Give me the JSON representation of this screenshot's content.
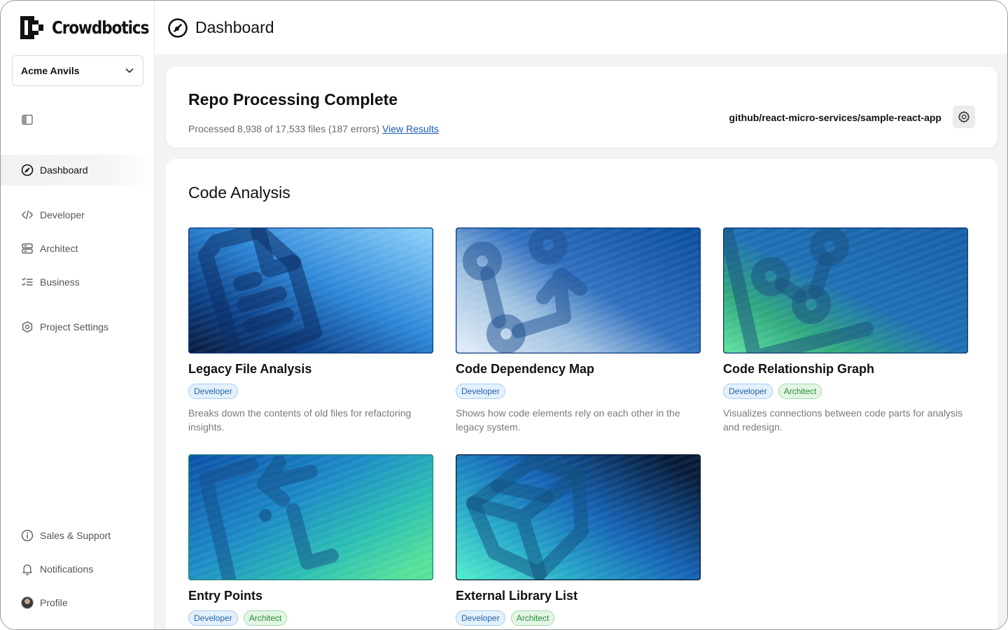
{
  "brand": {
    "name": "Crowdbotics"
  },
  "org_selector": {
    "value": "Acme Anvils"
  },
  "sidebar": {
    "nav": [
      {
        "label": "Dashboard",
        "icon": "dashboard-icon",
        "active": true
      },
      {
        "label": "Developer",
        "icon": "code-icon"
      },
      {
        "label": "Architect",
        "icon": "server-icon"
      },
      {
        "label": "Business",
        "icon": "checklist-icon"
      },
      {
        "label": "Project Settings",
        "icon": "settings-hexagon-icon"
      }
    ],
    "footer": [
      {
        "label": "Sales & Support",
        "icon": "info-icon"
      },
      {
        "label": "Notifications",
        "icon": "bell-icon"
      },
      {
        "label": "Profile",
        "icon": "avatar"
      }
    ]
  },
  "header": {
    "title": "Dashboard"
  },
  "status": {
    "title": "Repo Processing Complete",
    "summary": "Processed 8,938 of 17,533 files (187 errors)",
    "link": "View Results",
    "repo": "github/react-micro-services/sample-react-app"
  },
  "analysis": {
    "title": "Code Analysis",
    "cards": [
      {
        "title": "Legacy File Analysis",
        "tags": [
          "Developer"
        ],
        "description": "Breaks down the contents of old files for refactoring insights.",
        "icon": "file-document-icon"
      },
      {
        "title": "Code Dependency Map",
        "tags": [
          "Developer"
        ],
        "description": "Shows how code elements rely on each other in the legacy system.",
        "icon": "git-merge-icon"
      },
      {
        "title": "Code Relationship Graph",
        "tags": [
          "Developer",
          "Architect"
        ],
        "description": "Visualizes connections between code parts for analysis and redesign.",
        "icon": "graph-chart-icon"
      },
      {
        "title": "Entry Points",
        "tags": [
          "Developer",
          "Architect"
        ],
        "description": "",
        "icon": "entry-arrow-icon"
      },
      {
        "title": "External Library List",
        "tags": [
          "Developer",
          "Architect"
        ],
        "description": "",
        "icon": "package-box-icon"
      }
    ]
  },
  "colors": {
    "tag_developer_bg": "#e3f0fd",
    "tag_architect_bg": "#e2f6e4",
    "link": "#1a5bb8",
    "main_bg": "#f2f3f5"
  }
}
